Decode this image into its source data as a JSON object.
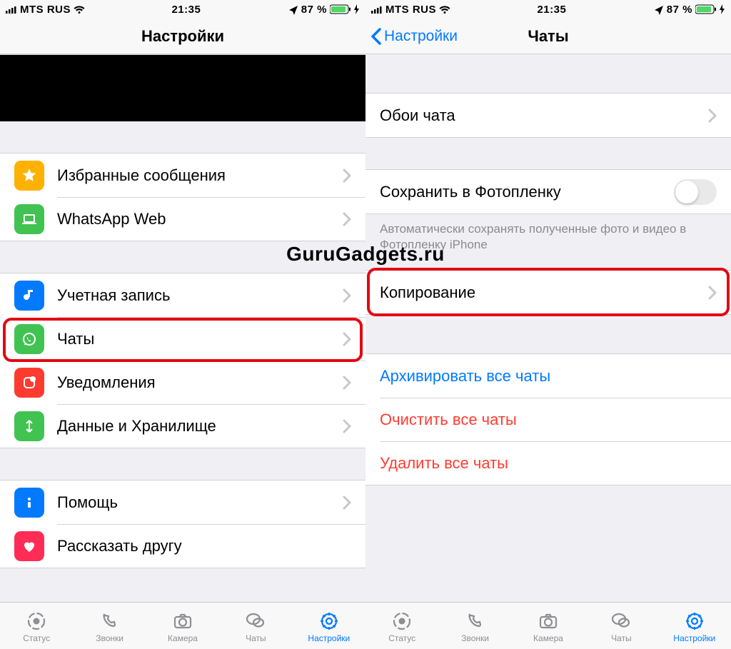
{
  "watermark": "GuruGadgets.ru",
  "status": {
    "carrier": "MTS RUS",
    "time": "21:35",
    "battery_pct": "87 %"
  },
  "screen1": {
    "title": "Настройки",
    "groups": {
      "g1": [
        {
          "label": "Избранные сообщения",
          "color": "#FFB100",
          "icon": "star"
        },
        {
          "label": "WhatsApp Web",
          "color": "#40C351",
          "icon": "laptop"
        }
      ],
      "g2": [
        {
          "label": "Учетная запись",
          "color": "#017AFD",
          "icon": "key"
        },
        {
          "label": "Чаты",
          "color": "#40C351",
          "icon": "whatsapp",
          "highlight": true
        },
        {
          "label": "Уведомления",
          "color": "#FF3B30",
          "icon": "notification"
        },
        {
          "label": "Данные и Хранилище",
          "color": "#40C351",
          "icon": "data"
        }
      ],
      "g3": [
        {
          "label": "Помощь",
          "color": "#017AFD",
          "icon": "info"
        },
        {
          "label": "Рассказать другу",
          "color": "#FF2D55",
          "icon": "heart"
        }
      ]
    }
  },
  "screen2": {
    "back": "Настройки",
    "title": "Чаты",
    "wallpaper": "Обои чата",
    "save_photo": "Сохранить в Фотопленку",
    "save_photo_note": "Автоматически сохранять полученные фото и видео в Фотопленку iPhone",
    "backup": "Копирование",
    "archive": "Архивировать все чаты",
    "clear": "Очистить все чаты",
    "delete": "Удалить все чаты"
  },
  "tabs": [
    {
      "label": "Статус",
      "icon": "status"
    },
    {
      "label": "Звонки",
      "icon": "phone"
    },
    {
      "label": "Камера",
      "icon": "camera"
    },
    {
      "label": "Чаты",
      "icon": "chats"
    },
    {
      "label": "Настройки",
      "icon": "settings",
      "active": true
    }
  ]
}
